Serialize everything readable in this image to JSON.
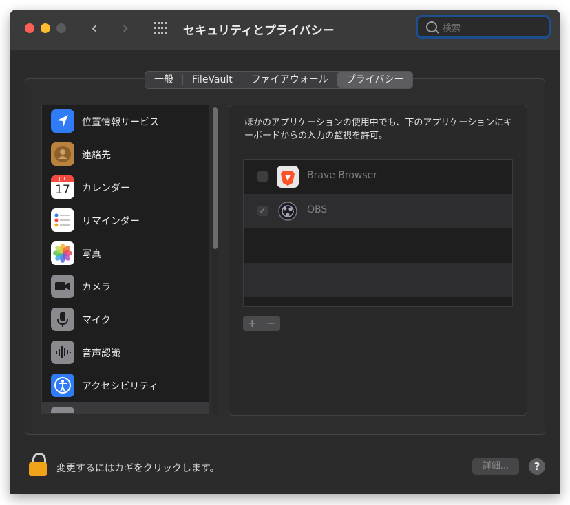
{
  "window": {
    "title": "セキュリティとプライバシー",
    "search_placeholder": "検索",
    "nav_back": "‹",
    "nav_forward": "›"
  },
  "tabs": [
    {
      "label": "一般",
      "selected": false
    },
    {
      "label": "FileVault",
      "selected": false
    },
    {
      "label": "ファイアウォール",
      "selected": false
    },
    {
      "label": "プライバシー",
      "selected": true
    }
  ],
  "sidebar": {
    "items": [
      {
        "label": "位置情報サービス",
        "icon": "location-arrow-icon",
        "color": "#2f7cf6"
      },
      {
        "label": "連絡先",
        "icon": "contacts-icon",
        "color": "#b9823f"
      },
      {
        "label": "カレンダー",
        "icon": "calendar-icon",
        "color": "#ffffff",
        "month": "JUL",
        "day": "17"
      },
      {
        "label": "リマインダー",
        "icon": "reminders-icon",
        "color": "#ffffff"
      },
      {
        "label": "写真",
        "icon": "photos-icon",
        "color": "#ffffff"
      },
      {
        "label": "カメラ",
        "icon": "camera-icon",
        "color": "#8a8a8e"
      },
      {
        "label": "マイク",
        "icon": "microphone-icon",
        "color": "#8a8a8e"
      },
      {
        "label": "音声認識",
        "icon": "speech-recognition-icon",
        "color": "#8a8a8e"
      },
      {
        "label": "アクセシビリティ",
        "icon": "accessibility-icon",
        "color": "#2f7cf6"
      }
    ]
  },
  "main": {
    "description": "ほかのアプリケーションの使用中でも、下のアプリケーションにキーボードからの入力の監視を許可。",
    "apps": [
      {
        "name": "Brave Browser",
        "checked": false,
        "icon": "brave-icon"
      },
      {
        "name": "OBS",
        "checked": true,
        "icon": "obs-icon"
      }
    ],
    "add_label": "+",
    "remove_label": "−"
  },
  "footer": {
    "lock_text": "変更するにはカギをクリックします。",
    "details_label": "詳細...",
    "help_label": "?"
  }
}
